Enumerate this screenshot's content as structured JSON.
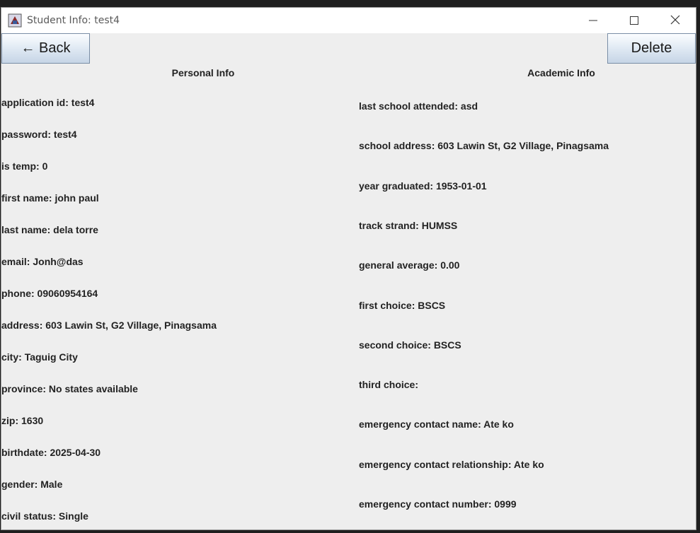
{
  "window": {
    "title": "Student Info: test4",
    "minimize_icon": "minimize-icon",
    "maximize_icon": "maximize-icon",
    "close_icon": "close-icon",
    "app_icon": "java-app-icon"
  },
  "toolbar": {
    "back_label": "← Back",
    "delete_label": "Delete"
  },
  "personal": {
    "header": "Personal Info",
    "fields": [
      {
        "label": "application id:",
        "value": "test4"
      },
      {
        "label": "password:",
        "value": "test4"
      },
      {
        "label": "is temp:",
        "value": "0"
      },
      {
        "label": "first name:",
        "value": "john paul"
      },
      {
        "label": "last name:",
        "value": "dela torre"
      },
      {
        "label": "email:",
        "value": "Jonh@das"
      },
      {
        "label": "phone:",
        "value": "09060954164"
      },
      {
        "label": "address:",
        "value": "603 Lawin St, G2 Village, Pinagsama"
      },
      {
        "label": "city:",
        "value": "Taguig City"
      },
      {
        "label": "province:",
        "value": "No states available"
      },
      {
        "label": "zip:",
        "value": "1630"
      },
      {
        "label": "birthdate:",
        "value": "2025-04-30"
      },
      {
        "label": "gender:",
        "value": "Male"
      },
      {
        "label": "civil status:",
        "value": "Single"
      }
    ]
  },
  "academic": {
    "header": "Academic Info",
    "fields": [
      {
        "label": "last school attended:",
        "value": "asd"
      },
      {
        "label": "school address:",
        "value": "603 Lawin St, G2 Village, Pinagsama"
      },
      {
        "label": "year graduated:",
        "value": "1953-01-01"
      },
      {
        "label": "track strand:",
        "value": "HUMSS"
      },
      {
        "label": "general average:",
        "value": "0.00"
      },
      {
        "label": "first choice:",
        "value": "BSCS"
      },
      {
        "label": "second choice:",
        "value": "BSCS"
      },
      {
        "label": "third choice:",
        "value": ""
      },
      {
        "label": "emergency contact name:",
        "value": "Ate ko"
      },
      {
        "label": "emergency contact relationship:",
        "value": "Ate ko"
      },
      {
        "label": "emergency contact number:",
        "value": "0999"
      }
    ]
  }
}
